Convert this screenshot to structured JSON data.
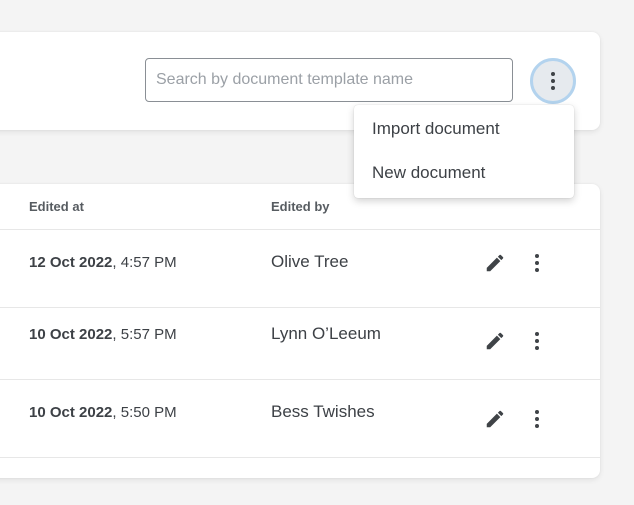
{
  "search": {
    "placeholder": "Search by document template name",
    "value": ""
  },
  "menu": {
    "items": [
      "Import document",
      "New document"
    ]
  },
  "table": {
    "columns": {
      "edited_at": "Edited at",
      "edited_by": "Edited by"
    },
    "rows": [
      {
        "date": "12 Oct 2022",
        "time": ", 4:57 PM",
        "editor": "Olive Tree"
      },
      {
        "date": "10 Oct 2022",
        "time": ", 5:57 PM",
        "editor": "Lynn O’Leeum"
      },
      {
        "date": "10 Oct 2022",
        "time": ", 5:50 PM",
        "editor": "Bess Twishes"
      }
    ]
  },
  "icons": {
    "edit": "pencil-icon",
    "more": "more-vertical-icon"
  },
  "colors": {
    "focus_ring": "#b3d3ee",
    "text": "#3d4146",
    "placeholder": "#9ba0a6"
  }
}
